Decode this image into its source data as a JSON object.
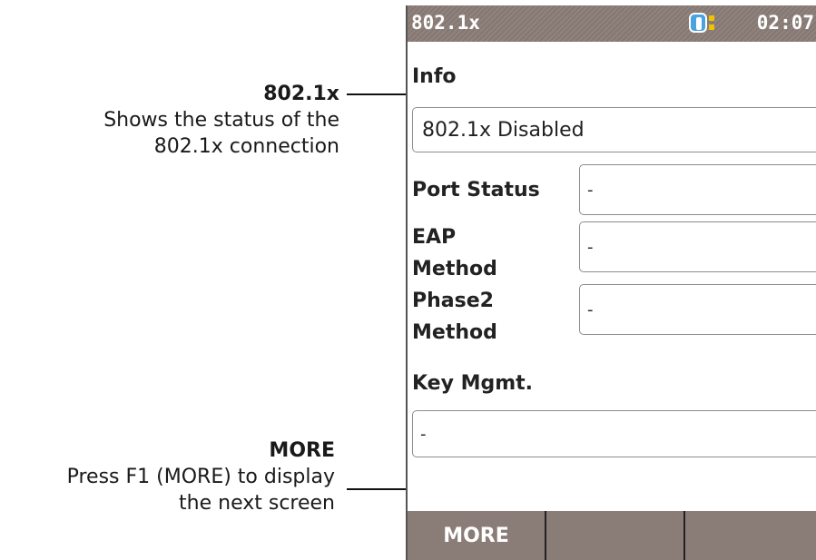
{
  "callouts": {
    "info": {
      "title": "802.1x",
      "desc_line1": "Shows the status of the",
      "desc_line2": "802.1x connection"
    },
    "more": {
      "title": "MORE",
      "desc_line1": "Press F1 (MORE) to display",
      "desc_line2": "the next screen"
    }
  },
  "titlebar": {
    "title": "802.1x",
    "time": "02:07",
    "battery_icon": "battery-icon"
  },
  "info": {
    "label": "Info",
    "value": "802.1x Disabled"
  },
  "port_status": {
    "label": "Port Status",
    "value": "-"
  },
  "eap_method": {
    "label_line1": "EAP",
    "label_line2": "Method",
    "value": "-"
  },
  "phase2_method": {
    "label_line1": "Phase2",
    "label_line2": "Method",
    "value": "-"
  },
  "key_mgmt": {
    "label": "Key Mgmt.",
    "value": "-"
  },
  "softkeys": {
    "f1": "MORE",
    "f2": "",
    "f3": ""
  },
  "colors": {
    "bar": "#8a7c76",
    "battery": "#4aa3e0",
    "battery_dots": "#f2c200"
  }
}
